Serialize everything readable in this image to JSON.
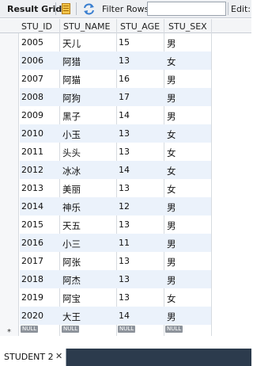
{
  "toolbar": {
    "result_grid_label": "Result Grid",
    "filter_label": "Filter Rows:",
    "filter_value": "",
    "edit_label": "Edit:"
  },
  "columns": [
    "STU_ID",
    "STU_NAME",
    "STU_AGE",
    "STU_SEX"
  ],
  "rows": [
    [
      "2005",
      "天儿",
      "15",
      "男"
    ],
    [
      "2006",
      "阿猎",
      "13",
      "女"
    ],
    [
      "2007",
      "阿猫",
      "16",
      "男"
    ],
    [
      "2008",
      "阿狗",
      "17",
      "男"
    ],
    [
      "2009",
      "黑子",
      "14",
      "男"
    ],
    [
      "2010",
      "小玉",
      "13",
      "女"
    ],
    [
      "2011",
      "头头",
      "13",
      "女"
    ],
    [
      "2012",
      "冰冰",
      "14",
      "女"
    ],
    [
      "2013",
      "美丽",
      "13",
      "女"
    ],
    [
      "2014",
      "神乐",
      "12",
      "男"
    ],
    [
      "2015",
      "天五",
      "13",
      "男"
    ],
    [
      "2016",
      "小三",
      "11",
      "男"
    ],
    [
      "2017",
      "阿张",
      "13",
      "男"
    ],
    [
      "2018",
      "阿杰",
      "13",
      "男"
    ],
    [
      "2019",
      "阿宝",
      "13",
      "女"
    ],
    [
      "2020",
      "大王",
      "14",
      "男"
    ]
  ],
  "new_row": {
    "marker": "*",
    "null_label": "NULL"
  },
  "bottom_tab": {
    "label": "STUDENT 2",
    "close": "✕"
  },
  "colors": {
    "alt_row": "#ebf2fb",
    "tab_bar": "#2c3b4d"
  },
  "icons": [
    "grid-icon",
    "refresh-icon"
  ]
}
